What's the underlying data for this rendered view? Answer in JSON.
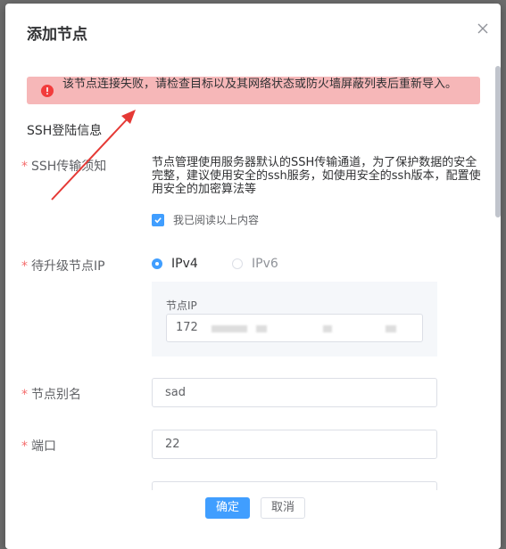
{
  "dialog": {
    "title": "添加节点",
    "close_icon": "close-icon"
  },
  "alert": {
    "icon": "error-circle-icon",
    "text": "该节点连接失败，请检查目标以及其网络状态或防火墙屏蔽列表后重新导入。",
    "color": "#f6b7b8"
  },
  "section": {
    "title": "SSH登陆信息"
  },
  "ssh_notice": {
    "label": "SSH传输须知",
    "text": "节点管理使用服务器默认的SSH传输通道，为了保护数据的安全完整，建议使用安全的ssh服务，如使用安全的ssh版本，配置使用安全的加密算法等",
    "checkbox_label": "我已阅读以上内容",
    "checked": true
  },
  "upgrade_ip": {
    "label": "待升级节点IP",
    "options": [
      {
        "label": "IPv4",
        "checked": true
      },
      {
        "label": "IPv6",
        "checked": false
      }
    ],
    "ip_label": "节点IP",
    "ip_value": "172"
  },
  "alias": {
    "label": "节点别名",
    "value": "sad"
  },
  "port": {
    "label": "端口",
    "value": "22"
  },
  "footer": {
    "confirm": "确定",
    "cancel": "取消"
  },
  "colors": {
    "primary": "#409eff",
    "required": "#f56c6c",
    "arrow": "#e53935"
  }
}
